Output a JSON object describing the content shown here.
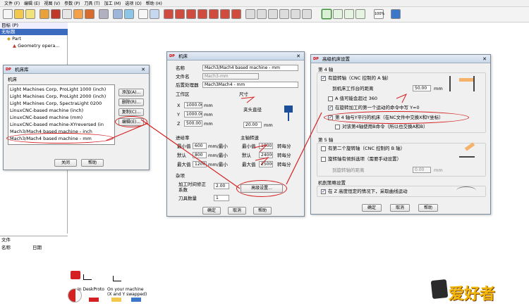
{
  "menu": {
    "items": [
      "文件 (F)",
      "编辑 (E)",
      "视图 (V)",
      "参数 (P)",
      "刀具 (T)",
      "加工 (M)",
      "选项 (O)",
      "帮助 (H)"
    ]
  },
  "toolbar": {
    "zoom_label": "100%"
  },
  "tree": {
    "rows": [
      "目标 (P)",
      "无标题",
      "Part",
      "Geometry opera..."
    ],
    "bottom_header": "文件",
    "columns": [
      "名称",
      "日期"
    ]
  },
  "library": {
    "title": "机床库",
    "section": "机床",
    "items": [
      "Light Machines Corp, ProLight 1000 (inch)",
      "Light Machines Corp, ProLight 2000 (inch)",
      "Light Machines Corp, SpectraLight 0200",
      "LinuxCNC-based machine (inch)",
      "LinuxCNC-based machine (mm)",
      "LinuxCNC-based machine-XYreversed (in",
      "Mach3/Mach4 based machine - inch",
      "Mach3/Mach4 based machine - mm"
    ],
    "buttons": {
      "add": "添加(A)...",
      "delete": "删除(R)...",
      "copy": "复制(C)...",
      "edit": "编辑(E)...",
      "close": "关闭",
      "help": "帮助"
    }
  },
  "machine": {
    "title": "机床",
    "name_label": "名称",
    "name_value": "Mach3/Mach4 based machine - mm",
    "file_label": "文件名",
    "file_value": "Mach3-mm",
    "post_label": "后置处理器",
    "post_value": "Mach3Mach4 - mm",
    "workspace_label": "工作区",
    "size_label": "尺寸",
    "x_label": "X",
    "x_value": "1000.00",
    "y_label": "Y",
    "y_value": "1000.00",
    "z_label": "Z",
    "z_value": "500.00",
    "unit_mm": "mm",
    "chuck_label": "夹头直径",
    "chuck_value": "20.00",
    "feed_label": "进给率",
    "feed_min_label": "最小值",
    "feed_min_value": "600",
    "feed_def_label": "默认",
    "feed_def_value": "800",
    "feed_max_label": "最大值",
    "feed_max_value": "1200",
    "feed_unit": "mm/最小",
    "spindle_label": "主轴转速",
    "sp_min_label": "最小值",
    "sp_min_value": "1000",
    "sp_def_label": "默认",
    "sp_def_value": "24000",
    "sp_max_label": "最大值",
    "sp_max_value": "25000",
    "sp_unit": "转每分",
    "misc_label": "杂项",
    "time_label": "加工时间修正系数",
    "time_value": "2.00",
    "tools_label": "刀具数量",
    "tools_value": "1",
    "advanced_btn": "高级设置...",
    "ok": "确定",
    "cancel": "取消",
    "help": "帮助"
  },
  "advanced": {
    "title": "高级机床设置",
    "axis4_label": "第 4 轴",
    "has_rotary": "有旋转轴（CNC 控制的 A 轴）",
    "dist_label": "到机床工作台的距离",
    "dist_value": "50.00",
    "unit_mm": "mm",
    "a_limit": "A 值可能会超过 360",
    "first_move": "在旋转加工的第一个运动的命令中写 Y=0",
    "parallel_y": "第 4 轴与Y平行的机床（在NC文件中交换X和Y坐标）",
    "swap_b": "对该第4轴使用B命令（所以也交换A和B）",
    "axis5_label": "第 5 轴",
    "has_second": "有第二个旋转轴（CNC 控制的 B 轴）",
    "dual_option": "旋转轴有倾斜选项（需要手动设置）",
    "dist2_label": "到旋转轴的距离",
    "dist2_value": "0.00",
    "strategy_label": "机削策略设置",
    "z_height": "在 Z 高度恒定的情况下，采取曲线运动",
    "ok": "确定",
    "cancel": "取消",
    "help": "帮助"
  },
  "bottom": {
    "label_a": "In DeskProto",
    "label_b": "On your machine",
    "label_c": "(X and Y swapped)"
  },
  "watermark": {
    "text": "爱好者"
  },
  "colors": {
    "annotation": "#d42020",
    "accent": "#3a7a3a"
  }
}
